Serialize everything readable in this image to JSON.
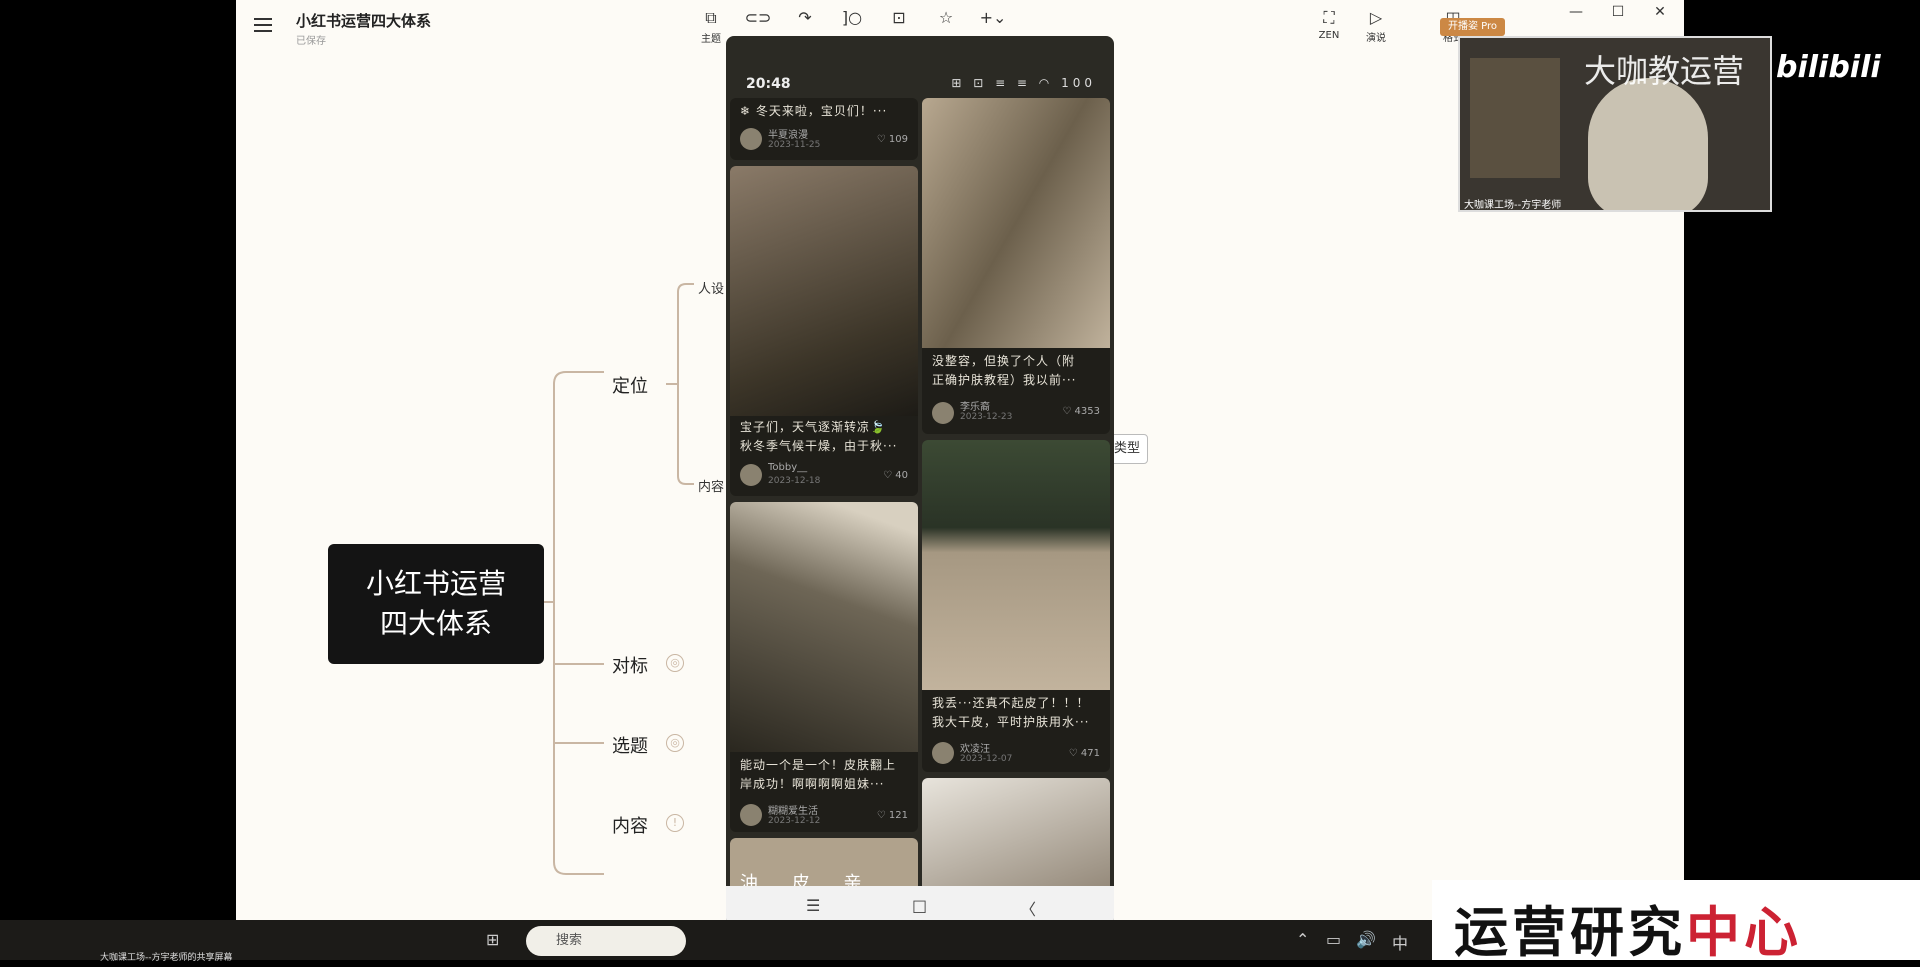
{
  "app": {
    "title": "小红书运营四大体系",
    "subtitle": "已保存",
    "toolbar": [
      {
        "icon": "topic-icon",
        "glyph": "⧉",
        "label": "主题"
      },
      {
        "icon": "subtopic-icon",
        "glyph": "⊂⊃",
        "label": ""
      },
      {
        "icon": "relation-icon",
        "glyph": "↷",
        "label": ""
      },
      {
        "icon": "summary-icon",
        "glyph": "]○",
        "label": ""
      },
      {
        "icon": "boundary-icon",
        "glyph": "⊡",
        "label": ""
      },
      {
        "icon": "marker-icon",
        "glyph": "☆",
        "label": ""
      },
      {
        "icon": "insert-icon",
        "glyph": "+⌄",
        "label": ""
      },
      {
        "icon": "zen-icon",
        "glyph": "⛶",
        "label": "ZEN"
      },
      {
        "icon": "present-icon",
        "glyph": "▷",
        "label": "演说"
      },
      {
        "icon": "format-icon",
        "glyph": "◫",
        "label": "格式"
      }
    ],
    "window_controls": [
      "—",
      "☐",
      "✕"
    ]
  },
  "mindmap": {
    "root": [
      "小红书运营",
      "四大体系"
    ],
    "branches": [
      "定位",
      "对标",
      "选题",
      "内容"
    ],
    "sub_top": "人设",
    "sub_bottom": "内容",
    "tag": "类型"
  },
  "phone": {
    "time": "20:48",
    "status_icons": "⊞ ⊡ ≡ ≡ ◠ 100",
    "top_card": {
      "title": "❄ 冬天来啦，宝贝们！···",
      "user": "半夏浪漫",
      "date": "2023-11-25",
      "likes": "♡ 109"
    },
    "cards": [
      {
        "title": [
          "宝子们，天气逐渐转凉🍃",
          "秋冬季气候干燥，由于秋···"
        ],
        "user": "Tobby__",
        "date": "2023-12-18",
        "likes": "♡ 40"
      },
      {
        "title": [
          "没整容，但换了个人（附",
          "正确护肤教程）我以前···"
        ],
        "user": "李乐裔",
        "date": "2023-12-23",
        "likes": "♡ 4353"
      },
      {
        "title": [
          "能动一个是一个！皮肤翻上",
          "岸成功！啊啊啊啊姐妹···"
        ],
        "user": "糊糊爱生活",
        "date": "2023-12-12",
        "likes": "♡ 121"
      },
      {
        "title": [
          "我丢···还真不起皮了！！！",
          "我大干皮，平时护肤用水···"
        ],
        "user": "欢凌汪",
        "date": "2023-12-07",
        "likes": "♡ 471"
      }
    ],
    "bottom_caption": "油 皮 亲 妈",
    "nav": [
      "☰",
      "□",
      "〈"
    ]
  },
  "webcam": {
    "badge": "开播姿 Pro",
    "caption": "大咖课工场--方宇老师",
    "watermark": "大咖教运营",
    "logo": "bilibili"
  },
  "banner": {
    "text_a": "运营研究",
    "text_b": "中心"
  },
  "taskbar": {
    "title": "大咖课工场--方宇老师的共享屏幕",
    "search": "搜索",
    "tray": [
      "⌃",
      "▭",
      "🔊",
      "中"
    ]
  },
  "colors": {
    "root_bg": "#141414",
    "line": "#c9b6a3",
    "canvas": "#fdfbf6"
  }
}
